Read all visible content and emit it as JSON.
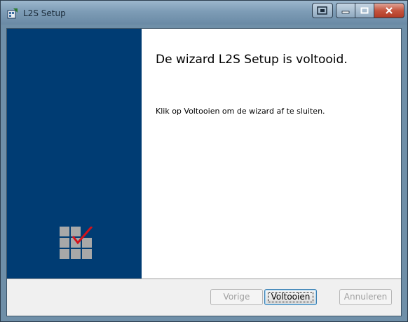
{
  "window": {
    "title": "L2S Setup",
    "icons": {
      "app": "installer-icon",
      "extra": "restore-window-icon",
      "minimize": "minimize-icon",
      "maximize": "maximize-icon",
      "close": "close-icon"
    },
    "colors": {
      "banner": "#003c73",
      "check": "#d3121b",
      "titlebar": "#7d9cb6"
    }
  },
  "content": {
    "heading": "De wizard L2S Setup is voltooid.",
    "body": "Klik op Voltooien om de wizard af te sluiten."
  },
  "buttons": {
    "back": {
      "label": "Vorige",
      "enabled": false
    },
    "finish": {
      "label": "Voltooien",
      "enabled": true,
      "default": true
    },
    "cancel": {
      "label": "Annuleren",
      "enabled": false
    }
  },
  "banner": {
    "logo": "checked-grid-logo"
  }
}
